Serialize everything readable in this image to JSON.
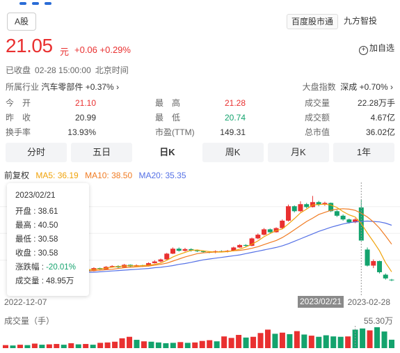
{
  "header": {
    "market_tab": "A股",
    "chip_baidu": "百度股市通",
    "chip_jiufang": "九方智投"
  },
  "quote": {
    "price": "21.05",
    "unit": "元",
    "change": "+0.06 +0.29%",
    "add_watchlist": "加自选",
    "status": "已收盘",
    "datetime": "02-28 15:00:00",
    "timezone": "北京时间",
    "industry_label": "所属行业",
    "industry_value": "汽车零部件 +0.37%",
    "index_label": "大盘指数",
    "index_value": "深成 +0.70%"
  },
  "stats": [
    {
      "k": "今　开",
      "v": "21.10",
      "color": "red"
    },
    {
      "k": "最　高",
      "v": "21.28",
      "color": "red"
    },
    {
      "k": "成交量",
      "v": "22.28万手",
      "color": ""
    },
    {
      "k": "昨　收",
      "v": "20.99",
      "color": ""
    },
    {
      "k": "最　低",
      "v": "20.74",
      "color": "green"
    },
    {
      "k": "成交额",
      "v": "4.67亿",
      "color": ""
    },
    {
      "k": "换手率",
      "v": "13.93%",
      "color": ""
    },
    {
      "k": "市盈(TTM)",
      "v": "149.31",
      "color": ""
    },
    {
      "k": "总市值",
      "v": "36.02亿",
      "color": ""
    }
  ],
  "tabs": [
    "分时",
    "五日",
    "日K",
    "周K",
    "月K",
    "1年"
  ],
  "active_tab": "日K",
  "ma": {
    "adjust": "前复权",
    "ma5": "MA5: 36.19",
    "ma10": "MA10: 38.50",
    "ma20": "MA20: 35.35",
    "colors": {
      "ma5": "#f0a30a",
      "ma10": "#f07b22",
      "ma20": "#5470e6"
    }
  },
  "tooltip": {
    "date": "2023/02/21",
    "open": "开盘 : 38.61",
    "high": "最高 : 40.50",
    "low": "最低 : 30.58",
    "close": "收盘 : 30.58",
    "change_label": "涨跌幅 : ",
    "change_value": "-20.01%",
    "volume": "成交量 : 48.95万"
  },
  "axis": {
    "start_date": "2022-12-07",
    "cursor_date": "2023/02/21",
    "end_date": "2023-02-28",
    "volume_label": "成交量（手）",
    "volume_max": "55.30万"
  },
  "colors": {
    "up": "#e93030",
    "down": "#13a36d"
  },
  "chart_data": {
    "type": "candlestick",
    "candles": [
      {
        "o": 22.9,
        "c": 23.1,
        "h": 23.4,
        "l": 22.7
      },
      {
        "o": 23.1,
        "c": 22.9,
        "h": 23.3,
        "l": 22.7
      },
      {
        "o": 22.9,
        "c": 23.4,
        "h": 23.6,
        "l": 22.8
      },
      {
        "o": 23.4,
        "c": 23.2,
        "h": 23.5,
        "l": 23.0
      },
      {
        "o": 23.2,
        "c": 23.9,
        "h": 24.1,
        "l": 23.1
      },
      {
        "o": 23.9,
        "c": 23.6,
        "h": 24.0,
        "l": 23.4
      },
      {
        "o": 23.6,
        "c": 24.2,
        "h": 24.4,
        "l": 23.5
      },
      {
        "o": 24.2,
        "c": 24.4,
        "h": 24.6,
        "l": 24.0
      },
      {
        "o": 24.4,
        "c": 24.1,
        "h": 24.6,
        "l": 23.9
      },
      {
        "o": 24.1,
        "c": 24.7,
        "h": 24.9,
        "l": 24.0
      },
      {
        "o": 24.7,
        "c": 24.3,
        "h": 24.8,
        "l": 24.1
      },
      {
        "o": 24.3,
        "c": 24.6,
        "h": 24.8,
        "l": 24.2
      },
      {
        "o": 24.6,
        "c": 24.4,
        "h": 24.7,
        "l": 24.2
      },
      {
        "o": 24.4,
        "c": 25.1,
        "h": 25.3,
        "l": 24.3
      },
      {
        "o": 25.1,
        "c": 25.5,
        "h": 25.8,
        "l": 25.0
      },
      {
        "o": 25.5,
        "c": 26.0,
        "h": 26.2,
        "l": 25.3
      },
      {
        "o": 26.0,
        "c": 27.4,
        "h": 27.6,
        "l": 25.9
      },
      {
        "o": 27.4,
        "c": 28.6,
        "h": 28.9,
        "l": 27.3
      },
      {
        "o": 28.6,
        "c": 28.1,
        "h": 28.9,
        "l": 27.9
      },
      {
        "o": 28.1,
        "c": 28.5,
        "h": 28.8,
        "l": 27.9
      },
      {
        "o": 28.5,
        "c": 28.2,
        "h": 28.7,
        "l": 27.9
      },
      {
        "o": 28.2,
        "c": 28.0,
        "h": 28.4,
        "l": 27.8
      },
      {
        "o": 28.0,
        "c": 27.8,
        "h": 28.2,
        "l": 27.6
      },
      {
        "o": 27.8,
        "c": 27.7,
        "h": 28.0,
        "l": 27.5
      },
      {
        "o": 27.7,
        "c": 28.0,
        "h": 28.2,
        "l": 27.5
      },
      {
        "o": 28.0,
        "c": 27.9,
        "h": 28.2,
        "l": 27.7
      },
      {
        "o": 27.9,
        "c": 28.1,
        "h": 28.3,
        "l": 27.7
      },
      {
        "o": 28.1,
        "c": 28.9,
        "h": 29.1,
        "l": 28.0
      },
      {
        "o": 28.9,
        "c": 29.5,
        "h": 29.7,
        "l": 28.8
      },
      {
        "o": 29.5,
        "c": 29.3,
        "h": 29.7,
        "l": 29.1
      },
      {
        "o": 29.3,
        "c": 31.1,
        "h": 31.3,
        "l": 29.2
      },
      {
        "o": 31.1,
        "c": 32.0,
        "h": 32.3,
        "l": 30.9
      },
      {
        "o": 32.0,
        "c": 33.3,
        "h": 33.6,
        "l": 31.8
      },
      {
        "o": 33.3,
        "c": 32.6,
        "h": 33.5,
        "l": 32.3
      },
      {
        "o": 32.6,
        "c": 33.6,
        "h": 33.8,
        "l": 32.5
      },
      {
        "o": 33.6,
        "c": 35.4,
        "h": 35.7,
        "l": 33.4
      },
      {
        "o": 35.4,
        "c": 38.9,
        "h": 39.3,
        "l": 35.2
      },
      {
        "o": 38.9,
        "c": 37.7,
        "h": 39.1,
        "l": 37.4
      },
      {
        "o": 37.7,
        "c": 39.4,
        "h": 40.1,
        "l": 37.5
      },
      {
        "o": 39.4,
        "c": 38.7,
        "h": 39.7,
        "l": 38.4
      },
      {
        "o": 38.7,
        "c": 39.9,
        "h": 41.4,
        "l": 38.6
      },
      {
        "o": 39.9,
        "c": 39.3,
        "h": 40.2,
        "l": 38.9
      },
      {
        "o": 39.3,
        "c": 39.7,
        "h": 40.0,
        "l": 39.0
      },
      {
        "o": 39.7,
        "c": 37.7,
        "h": 39.8,
        "l": 37.5
      },
      {
        "o": 37.7,
        "c": 36.6,
        "h": 38.0,
        "l": 36.3
      },
      {
        "o": 36.6,
        "c": 35.7,
        "h": 36.9,
        "l": 35.4
      },
      {
        "o": 35.7,
        "c": 35.0,
        "h": 35.9,
        "l": 34.7
      },
      {
        "o": 35.0,
        "c": 35.7,
        "h": 36.0,
        "l": 34.8
      },
      {
        "o": 38.61,
        "c": 30.58,
        "h": 40.5,
        "l": 30.58
      },
      {
        "o": 28.4,
        "c": 24.5,
        "h": 28.9,
        "l": 24.3
      },
      {
        "o": 24.5,
        "c": 25.6,
        "h": 26.0,
        "l": 23.9
      },
      {
        "o": 25.6,
        "c": 22.9,
        "h": 25.7,
        "l": 22.6
      },
      {
        "o": 22.3,
        "c": 21.4,
        "h": 22.6,
        "l": 21.1
      },
      {
        "o": 21.1,
        "c": 21.05,
        "h": 21.28,
        "l": 20.74
      }
    ],
    "ma5": [
      23.6,
      23.6,
      23.5,
      23.5,
      23.6,
      23.7,
      23.9,
      24.1,
      24.3,
      24.4,
      24.5,
      24.4,
      24.5,
      24.6,
      24.8,
      25.1,
      25.8,
      26.6,
      27.2,
      27.7,
      28.2,
      28.3,
      28.1,
      27.9,
      27.8,
      27.8,
      27.9,
      28.1,
      28.5,
      29.0,
      29.7,
      30.5,
      31.5,
      32.3,
      33.0,
      33.4,
      34.6,
      35.9,
      37.3,
      38.2,
      39.2,
      39.3,
      39.4,
      39.2,
      38.6,
      37.6,
      36.8,
      36.3,
      34.7,
      32.4,
      30.3,
      28.1,
      25.2,
      23.0
    ],
    "ma10": [
      22.9,
      23.0,
      23.1,
      23.2,
      23.3,
      23.4,
      23.5,
      23.6,
      23.8,
      24.0,
      24.1,
      24.2,
      24.3,
      24.4,
      24.6,
      24.8,
      25.1,
      25.6,
      26.1,
      26.6,
      27.0,
      27.4,
      27.6,
      27.7,
      27.8,
      27.9,
      28.0,
      28.1,
      28.2,
      28.4,
      28.7,
      29.1,
      29.6,
      30.1,
      30.6,
      31.3,
      32.2,
      33.2,
      34.2,
      35.2,
      36.0,
      36.9,
      37.4,
      37.9,
      38.2,
      38.3,
      38.2,
      37.9,
      37.2,
      36.3,
      35.1,
      33.6,
      31.7,
      29.7
    ],
    "ma20": [
      22.7,
      22.7,
      22.8,
      22.9,
      22.9,
      23.0,
      23.1,
      23.2,
      23.3,
      23.4,
      23.5,
      23.6,
      23.7,
      23.8,
      24.0,
      24.1,
      24.3,
      24.5,
      24.8,
      25.0,
      25.3,
      25.6,
      25.9,
      26.1,
      26.3,
      26.5,
      26.7,
      26.9,
      27.1,
      27.4,
      27.7,
      28.0,
      28.3,
      28.6,
      28.9,
      29.3,
      29.8,
      30.4,
      31.0,
      31.6,
      32.2,
      32.8,
      33.3,
      33.8,
      34.2,
      34.6,
      34.9,
      35.1,
      35.2,
      35.3,
      35.2,
      35.1,
      34.8,
      34.3
    ],
    "volumes": [
      8,
      7,
      9,
      8,
      12,
      9,
      10,
      11,
      9,
      13,
      10,
      11,
      9,
      14,
      15,
      17,
      26,
      30,
      22,
      18,
      17,
      15,
      13,
      14,
      16,
      14,
      15,
      19,
      21,
      18,
      31,
      27,
      35,
      28,
      30,
      40,
      49,
      38,
      41,
      37,
      45,
      36,
      33,
      30,
      34,
      31,
      30,
      31,
      48.95,
      52,
      47,
      55.3,
      44,
      22.28
    ],
    "price_range": [
      18,
      44
    ],
    "volume_max": 55.3
  }
}
